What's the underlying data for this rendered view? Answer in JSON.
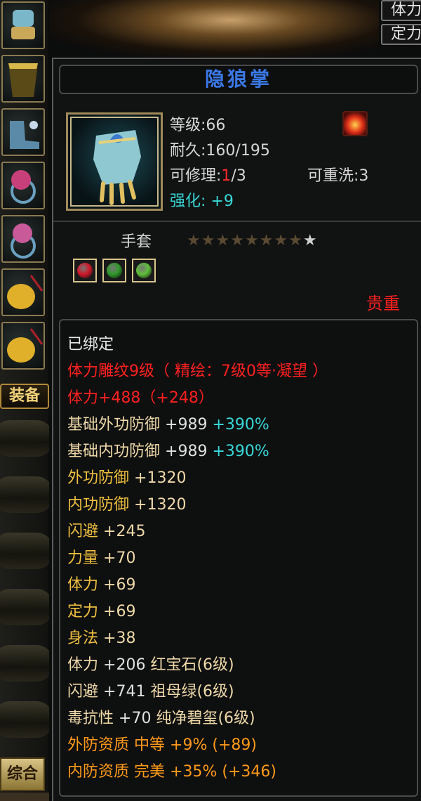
{
  "top_buttons": [
    "体力",
    "定力"
  ],
  "sidebar": {
    "equip_tab": "装备",
    "bottom_tab": "综合"
  },
  "item": {
    "name": "隐狼掌",
    "level_label": "等级:",
    "level": "66",
    "durability_label": "耐久:",
    "durability": "160/195",
    "repair_label": "可修理:",
    "repair_used": "1",
    "repair_total": "/3",
    "rewash_label": "可重洗:",
    "rewash": "3",
    "enhance_label": "强化: ",
    "enhance": "+9",
    "type": "手套",
    "stars_total": 9,
    "stars_filled": 8,
    "rarity": "贵重",
    "gem_colors": [
      "#d0182a",
      "#2f9a2a",
      "#5fbf3a"
    ]
  },
  "attributes": [
    {
      "text": "已绑定",
      "color": "white"
    },
    {
      "text": "体力雕纹9级（ 精绘：7级0等·凝望 ）",
      "color": "red"
    },
    {
      "text": "体力+488（+248）",
      "color": "red"
    },
    {
      "label": "基础外功防御",
      "value": "+989",
      "extra": "+390%",
      "color": "cream"
    },
    {
      "label": "基础内功防御",
      "value": "+989",
      "extra": "+390%",
      "color": "cream"
    },
    {
      "label": "外功防御",
      "value": "+1320",
      "color": "gold"
    },
    {
      "label": "内功防御",
      "value": "+1320",
      "color": "gold"
    },
    {
      "label": "闪避",
      "value": "+245",
      "color": "gold"
    },
    {
      "label": "力量",
      "value": "+70",
      "color": "gold"
    },
    {
      "label": "体力",
      "value": "+69",
      "color": "gold"
    },
    {
      "label": "定力",
      "value": "+69",
      "color": "gold"
    },
    {
      "label": "身法",
      "value": "+38",
      "color": "gold"
    },
    {
      "label": "体力",
      "value": "+206",
      "extra": "红宝石(6级)",
      "color": "cream"
    },
    {
      "label": "闪避",
      "value": "+741",
      "extra": "祖母绿(6级)",
      "color": "cream"
    },
    {
      "label": "毒抗性",
      "value": "+70",
      "extra": "纯净碧玺(6级)",
      "color": "cream"
    },
    {
      "label": "外防资质",
      "grade": "中等",
      "value": "+9%",
      "extra": "(+89)",
      "color": "orange"
    },
    {
      "label": "内防资质",
      "grade": "完美",
      "value": "+35%",
      "extra": "(+346)",
      "color": "orange"
    }
  ]
}
